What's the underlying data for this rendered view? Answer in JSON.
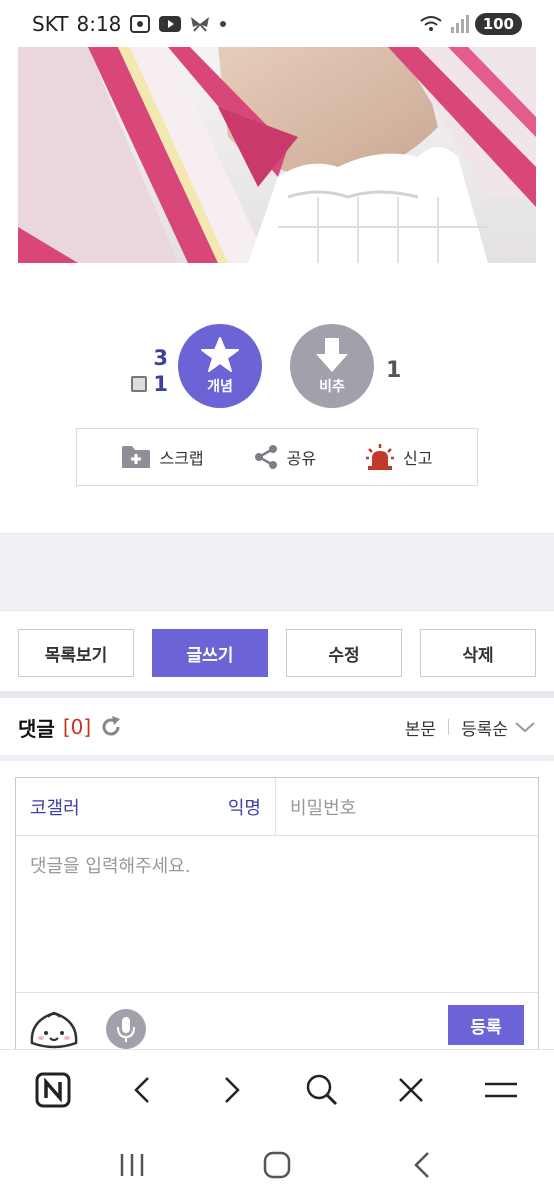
{
  "status_bar": {
    "carrier": "SKT",
    "time": "8:18",
    "battery": "100",
    "icons": [
      "screenshot-icon",
      "youtube-icon",
      "butterfly-icon",
      "dot-icon",
      "wifi-icon",
      "signal-icon"
    ]
  },
  "post": {
    "image_icon": "post-photo"
  },
  "vote": {
    "up_count": "3",
    "mobile_up_count": "1",
    "up_label": "개념",
    "down_label": "비추",
    "down_count": "1"
  },
  "actions": {
    "scrap": "스크랩",
    "share": "공유",
    "report": "신고"
  },
  "buttons": {
    "list": "목록보기",
    "write": "글쓰기",
    "edit": "수정",
    "delete": "삭제"
  },
  "comments": {
    "title": "댓글",
    "count": "[0]",
    "view_option": "본문",
    "sort_option": "등록순"
  },
  "form": {
    "nickname": "코갤러",
    "anon_label": "익명",
    "password_placeholder": "비밀번호",
    "comment_placeholder": "댓글을 입력해주세요.",
    "submit_label": "등록"
  },
  "colors": {
    "accent": "#6c63d6",
    "link_blue": "#3b3fa6",
    "report_red": "#c0392b",
    "gray_button": "#a3a0ab"
  }
}
